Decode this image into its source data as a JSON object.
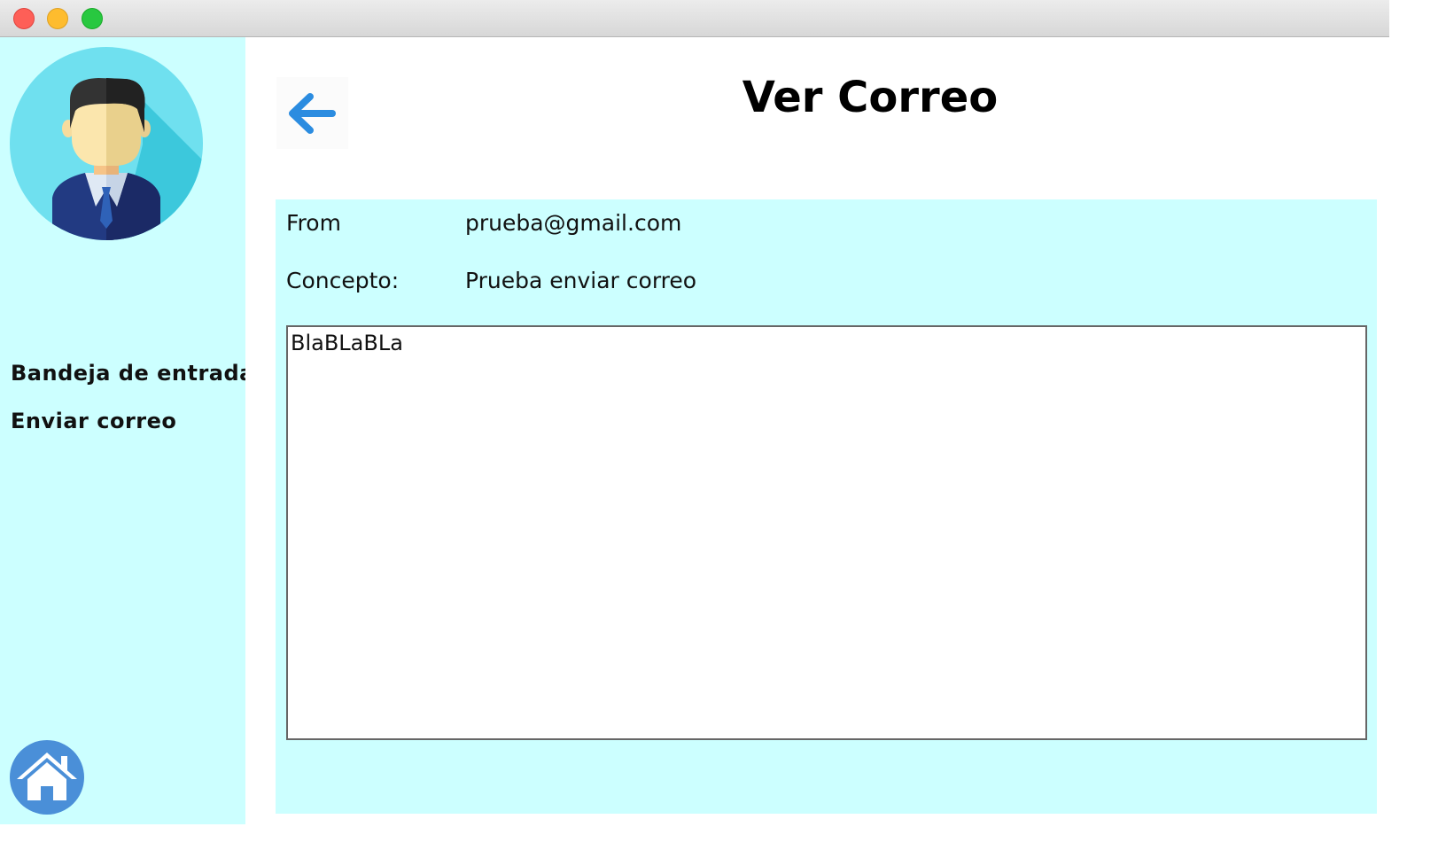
{
  "window": {
    "buttons": [
      "close",
      "minimize",
      "maximize"
    ]
  },
  "sidebar": {
    "avatar_icon": "user-avatar-icon",
    "items": [
      {
        "label": "Bandeja de entrada"
      },
      {
        "label": "Enviar correo"
      }
    ],
    "home_icon": "home-icon"
  },
  "header": {
    "title": "Ver Correo",
    "back_icon": "arrow-left-icon"
  },
  "mail": {
    "from_label": "From",
    "from_value": "prueba@gmail.com",
    "concept_label": "Concepto:",
    "concept_value": "Prueba enviar correo",
    "body": "BlaBLaBLa"
  },
  "colors": {
    "sidebar_bg": "#ccffff",
    "panel_bg": "#ccffff",
    "accent_blue": "#2b8ce0",
    "home_circle": "#4a8fd8"
  }
}
